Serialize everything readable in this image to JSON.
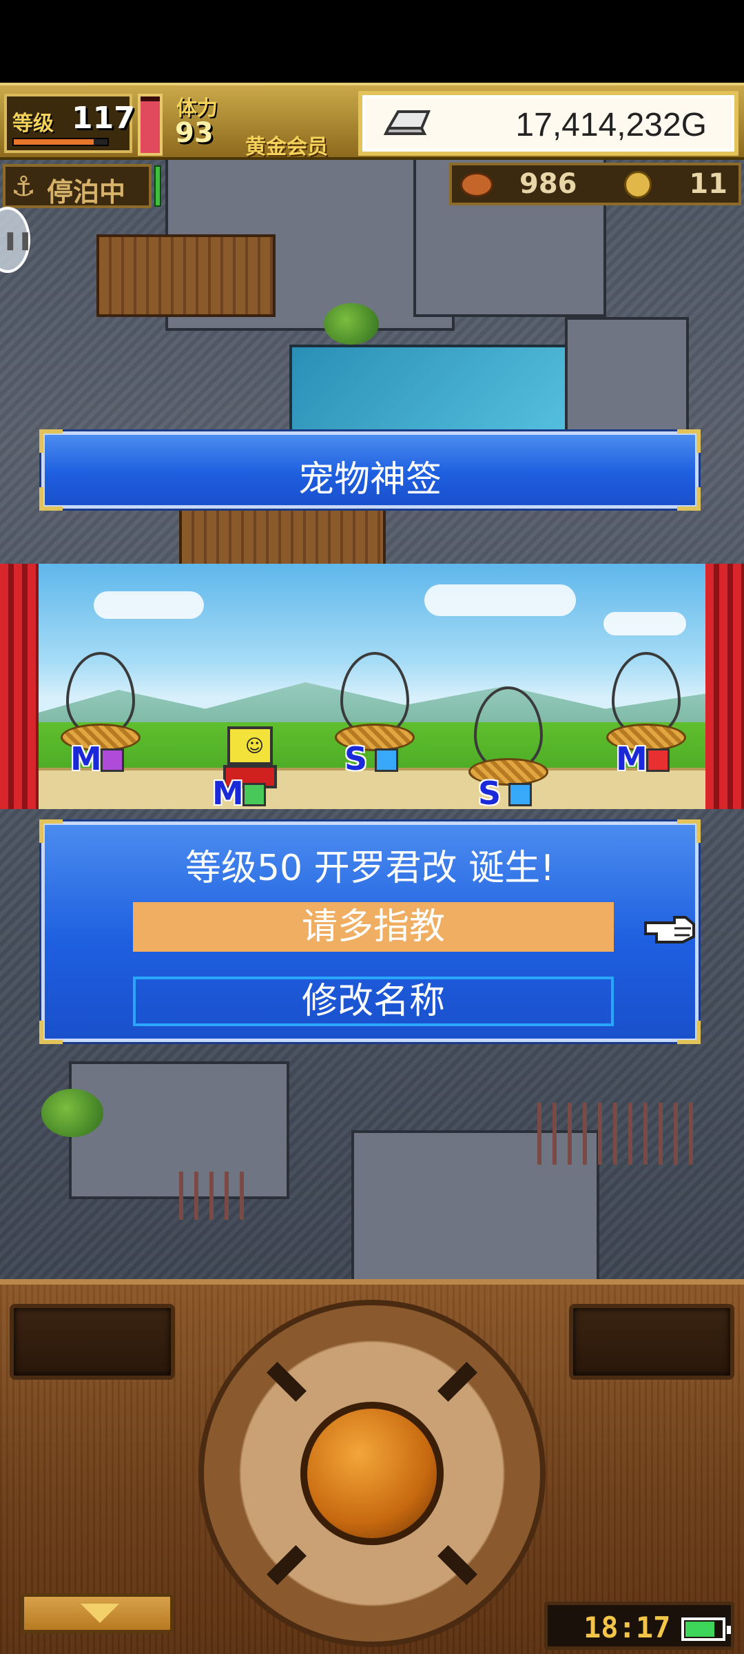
{
  "hud": {
    "level_label": "等级",
    "level_value": "117",
    "exp_fraction": 0.85,
    "hp_fraction": 0.92,
    "stamina_label": "体力",
    "stamina_value": "93",
    "member_label": "黄金会员",
    "gold_value": "17,414,232G",
    "dock_status": "停泊中",
    "food_value": "986",
    "coin_value": "11"
  },
  "title_panel": {
    "title": "宠物神签"
  },
  "stage": {
    "eggs": [
      {
        "tag": "M",
        "color": "white",
        "type_color": "#b04ad8"
      },
      {
        "tag": "S",
        "color": "white",
        "type_color": "#38a8f8"
      },
      {
        "tag": "S",
        "color": "pink",
        "type_color": "#38a8f8"
      },
      {
        "tag": "M",
        "color": "pink",
        "type_color": "#e83030"
      }
    ],
    "pet_tag": "M"
  },
  "result_panel": {
    "message": "等级50 开罗君改 诞生!",
    "confirm_label": "请多指教",
    "rename_label": "修改名称"
  },
  "console": {
    "clock": "18:17",
    "battery_fraction": 0.8
  },
  "colors": {
    "panel_blue": "#1e5fe0",
    "highlight_button": "#efae62",
    "gold_frame": "#e2c35a"
  }
}
